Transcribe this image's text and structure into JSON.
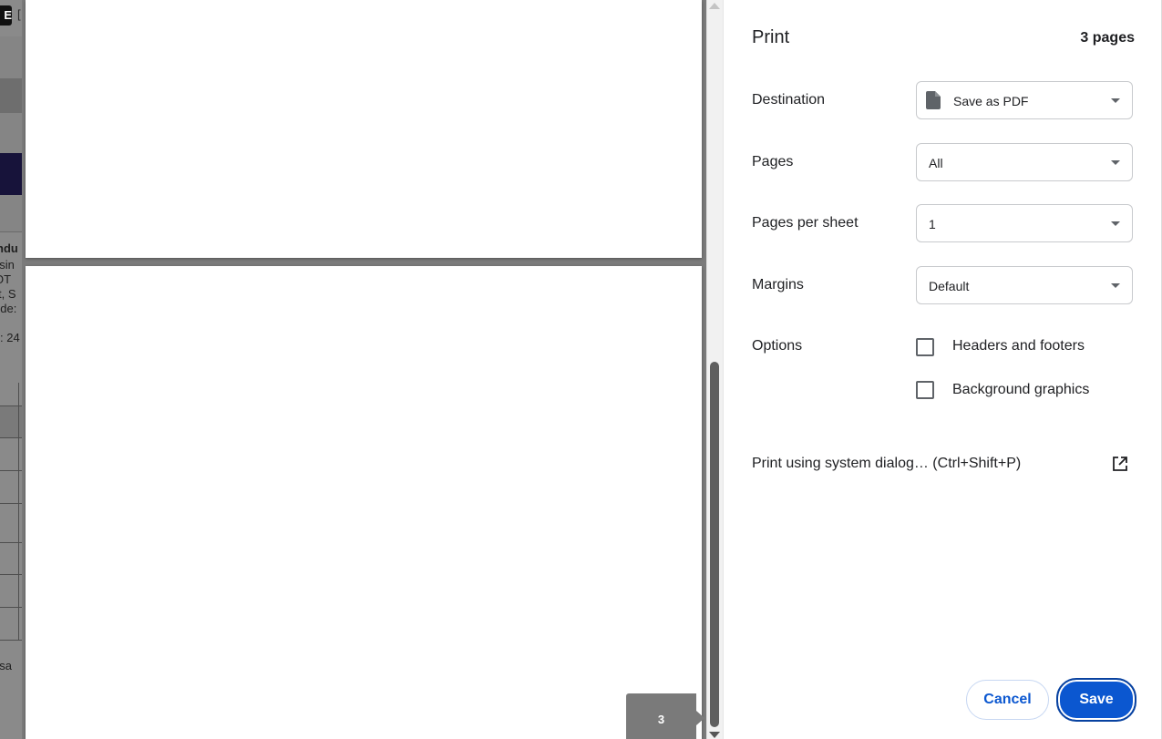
{
  "background_page": {
    "logo_letter": "E",
    "bracket": "[",
    "fragments": [
      "ndu",
      "usin",
      "OT",
      "t, S",
      "ode:",
      ": 24",
      "usa"
    ]
  },
  "preview": {
    "page_badge": "3"
  },
  "print": {
    "title": "Print",
    "page_count": "3 pages",
    "destination": {
      "label": "Destination",
      "value": "Save as PDF",
      "icon": "file-icon"
    },
    "pages": {
      "label": "Pages",
      "value": "All"
    },
    "pages_per_sheet": {
      "label": "Pages per sheet",
      "value": "1"
    },
    "margins": {
      "label": "Margins",
      "value": "Default"
    },
    "options": {
      "label": "Options",
      "headers_footers": {
        "label": "Headers and footers",
        "checked": false
      },
      "background_graphics": {
        "label": "Background graphics",
        "checked": false
      }
    },
    "system_dialog": {
      "label": "Print using system dialog… (Ctrl+Shift+P)",
      "icon": "open-in-new-icon"
    },
    "cancel_label": "Cancel",
    "save_label": "Save"
  },
  "colors": {
    "accent": "#0b57d0",
    "preview_bg": "#7b7b7b"
  }
}
